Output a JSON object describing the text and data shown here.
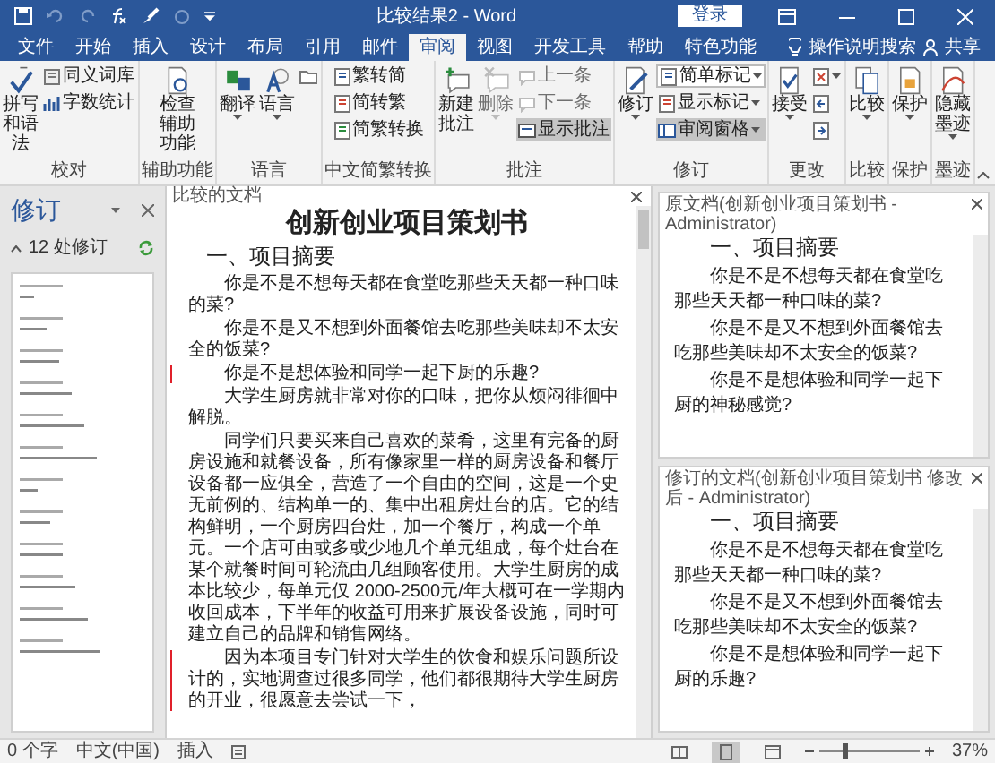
{
  "window": {
    "title": "比较结果2 - Word",
    "sign_in": "登录"
  },
  "tabs": [
    {
      "label": "文件",
      "selected": false
    },
    {
      "label": "开始",
      "selected": false
    },
    {
      "label": "插入",
      "selected": false
    },
    {
      "label": "设计",
      "selected": false
    },
    {
      "label": "布局",
      "selected": false
    },
    {
      "label": "引用",
      "selected": false
    },
    {
      "label": "邮件",
      "selected": false
    },
    {
      "label": "审阅",
      "selected": true
    },
    {
      "label": "视图",
      "selected": false
    },
    {
      "label": "开发工具",
      "selected": false
    },
    {
      "label": "帮助",
      "selected": false
    },
    {
      "label": "特色功能",
      "selected": false
    }
  ],
  "tell_me": "操作说明搜索",
  "share": "共享",
  "ribbon": [
    {
      "label": "校对",
      "items": [
        {
          "kind": "large",
          "label": "拼写和语法",
          "disabled": false,
          "on": false,
          "menu": false
        },
        {
          "kind": "small",
          "label": "同义词库",
          "disabled": false,
          "on": false,
          "menu": false
        },
        {
          "kind": "small",
          "label": "字数统计",
          "disabled": false,
          "on": false,
          "menu": false
        }
      ]
    },
    {
      "label": "辅助功能",
      "items": [
        {
          "kind": "large",
          "label": "检查辅助功能",
          "disabled": false,
          "on": false,
          "menu": false
        }
      ]
    },
    {
      "label": "语言",
      "items": [
        {
          "kind": "large",
          "label": "翻译",
          "disabled": false,
          "on": false,
          "menu": true
        },
        {
          "kind": "large",
          "label": "语言",
          "disabled": false,
          "on": false,
          "menu": true
        },
        {
          "kind": "icon",
          "disabled": false,
          "on": false,
          "menu": false
        }
      ]
    },
    {
      "label": "中文简繁转换",
      "items": [
        {
          "kind": "small",
          "label": "繁转简",
          "disabled": false,
          "on": false,
          "menu": false
        },
        {
          "kind": "small",
          "label": "简转繁",
          "disabled": false,
          "on": false,
          "menu": false
        },
        {
          "kind": "small",
          "label": "简繁转换",
          "disabled": false,
          "on": false,
          "menu": false
        }
      ]
    },
    {
      "label": "批注",
      "items": [
        {
          "kind": "large",
          "label": "新建批注",
          "disabled": false,
          "on": false,
          "menu": false
        },
        {
          "kind": "large",
          "label": "删除",
          "disabled": true,
          "on": false,
          "menu": true
        },
        {
          "kind": "small",
          "label": "上一条",
          "disabled": true,
          "on": false,
          "menu": false
        },
        {
          "kind": "small",
          "label": "下一条",
          "disabled": true,
          "on": false,
          "menu": false
        },
        {
          "kind": "small",
          "label": "显示批注",
          "disabled": false,
          "on": true,
          "menu": false
        }
      ]
    },
    {
      "label": "修订",
      "items": [
        {
          "kind": "large",
          "label": "修订",
          "disabled": false,
          "on": false,
          "menu": true
        },
        {
          "kind": "combo",
          "label": "简单标记",
          "disabled": false,
          "on": false,
          "menu": true
        },
        {
          "kind": "small",
          "label": "显示标记",
          "disabled": false,
          "on": false,
          "menu": true
        },
        {
          "kind": "small",
          "label": "审阅窗格",
          "disabled": false,
          "on": true,
          "menu": true
        }
      ]
    },
    {
      "label": "更改",
      "items": [
        {
          "kind": "large",
          "label": "接受",
          "disabled": false,
          "on": false,
          "menu": true
        },
        {
          "kind": "icon",
          "disabled": false,
          "on": false,
          "menu": true
        },
        {
          "kind": "icon",
          "disabled": false,
          "on": false,
          "menu": false
        },
        {
          "kind": "icon",
          "disabled": false,
          "on": false,
          "menu": false
        }
      ]
    },
    {
      "label": "比较",
      "items": [
        {
          "kind": "large",
          "label": "比较",
          "disabled": false,
          "on": false,
          "menu": true
        }
      ]
    },
    {
      "label": "保护",
      "items": [
        {
          "kind": "large",
          "label": "保护",
          "disabled": false,
          "on": false,
          "menu": true
        }
      ]
    },
    {
      "label": "墨迹",
      "items": [
        {
          "kind": "large",
          "label": "隐藏墨迹",
          "disabled": false,
          "on": false,
          "menu": true
        }
      ]
    }
  ],
  "revisions_pane": {
    "title": "修订",
    "count": "12 处修订"
  },
  "compared_document": {
    "header": "比较的文档",
    "title": "创新创业项目策划书",
    "heading": "一、项目摘要",
    "paragraphs": [
      {
        "text": "你是不是不想每天都在食堂吃那些天天都一种口味的菜?",
        "changed": false
      },
      {
        "text": "你是不是又不想到外面餐馆去吃那些美味却不太安全的饭菜?",
        "changed": false
      },
      {
        "text": "你是不是想体验和同学一起下厨的乐趣?",
        "changed": true
      },
      {
        "text": "大学生厨房就非常对你的口味，把你从烦闷徘徊中解脱。",
        "changed": false
      },
      {
        "text": "同学们只要买来自己喜欢的菜肴，这里有完备的厨房设施和就餐设备，所有像家里一样的厨房设备和餐厅设备都一应俱全，营造了一个自由的空间，这是一个史无前例的、结构单一的、集中出租房灶台的店。它的结构鲜明，一个厨房四台灶，加一个餐厅，构成一个单元。一个店可由或多或少地几个单元组成，每个灶台在某个就餐时间可轮流由几组顾客使用。大学生厨房的成本比较少，每单元仅 2000-2500元/年大概可在一学期内收回成本，下半年的收益可用来扩展设备设施，同时可建立自己的品牌和销售网络。",
        "changed": false
      },
      {
        "text": "因为本项目专门针对大学生的饮食和娱乐问题所设计的，实地调查过很多同学，他们都很期待大学生厨房的开业，很愿意去尝试一下，",
        "changed": true
      }
    ]
  },
  "original_document": {
    "header": "原文档(创新创业项目策划书 - Administrator)",
    "heading": "一、项目摘要",
    "paragraphs": [
      "你是不是不想每天都在食堂吃那些天天都一种口味的菜?",
      "你是不是又不想到外面餐馆去吃那些美味却不太安全的饭菜?",
      "你是不是想体验和同学一起下厨的神秘感觉?"
    ]
  },
  "revised_document": {
    "header": "修订的文档(创新创业项目策划书 修改后 - Administrator)",
    "heading": "一、项目摘要",
    "paragraphs": [
      "你是不是不想每天都在食堂吃那些天天都一种口味的菜?",
      "你是不是又不想到外面餐馆去吃那些美味却不太安全的饭菜?",
      "你是不是想体验和同学一起下厨的乐趣?"
    ]
  },
  "status_bar": {
    "words": "0 个字",
    "language": "中文(中国)",
    "mode": "插入",
    "views": [
      {
        "selected": false
      },
      {
        "selected": true
      },
      {
        "selected": false
      }
    ],
    "zoom": {
      "level": 0.25,
      "reading": "37%"
    }
  }
}
